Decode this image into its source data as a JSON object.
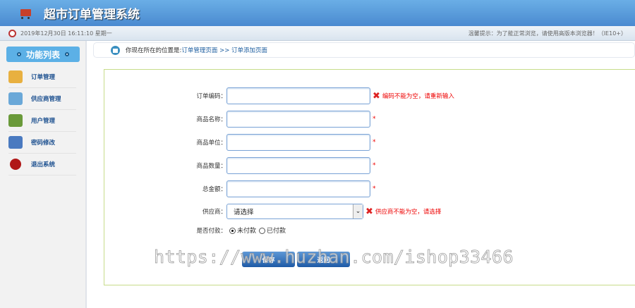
{
  "header": {
    "title": "超市订单管理系统"
  },
  "infobar": {
    "datetime": "2019年12月30日 16:11:10 星期一",
    "tip": "温馨提示：为了能正常浏览，请使用高版本浏览器！（IE10+）"
  },
  "sidebar": {
    "heading": "功能列表",
    "items": [
      {
        "label": "订单管理",
        "color": "#e8b040"
      },
      {
        "label": "供应商管理",
        "color": "#6aa8d8"
      },
      {
        "label": "用户管理",
        "color": "#6a9a3a"
      },
      {
        "label": "密码修改",
        "color": "#4a7ac0"
      },
      {
        "label": "退出系统",
        "color": "#b01818"
      }
    ]
  },
  "breadcrumb": {
    "prefix": "你现在所在的位置是:",
    "path": "订单管理页面 >> 订单添加页面"
  },
  "form": {
    "order_code": {
      "label": "订单编码：",
      "value": "",
      "error": "编码不能为空，请重新输入"
    },
    "product_name": {
      "label": "商品名称：",
      "value": "",
      "required": "*"
    },
    "product_unit": {
      "label": "商品单位：",
      "value": "",
      "required": "*"
    },
    "product_count": {
      "label": "商品数量：",
      "value": "",
      "required": "*"
    },
    "total": {
      "label": "总金额：",
      "value": "",
      "required": "*"
    },
    "provider": {
      "label": "供应商：",
      "selected": "请选择",
      "error": "供应商不能为空，请选择"
    },
    "paid": {
      "label": "是否付款：",
      "options": [
        "未付款",
        "已付款"
      ],
      "selected": "未付款"
    },
    "save_label": "保存",
    "back_label": "返回"
  },
  "watermark": "https://www.huzhan.com/ishop33466"
}
